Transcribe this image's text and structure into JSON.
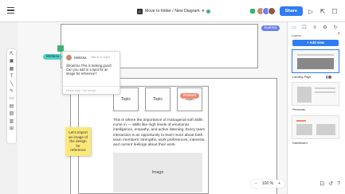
{
  "header": {
    "breadcrumb": "Move to folder / New Diagram",
    "logo_letter": "C",
    "share_label": "Share"
  },
  "canvas": {
    "topics": [
      "Topic",
      "Topic",
      "Topic"
    ],
    "body_text": "This is where the importance of managerial soft skills come in — skills like high levels of emotional intelligence, empathy, and active listening. Every team interaction is an opportunity to learn more about both team members' strengths, work preferences, interests, and current feelings about their work.",
    "image_label": "Image",
    "sticky_note": "Let's import an image of the design for reference",
    "cursors": {
      "katrina": "Katrina",
      "melissa": "Melissa",
      "russell": "Russell"
    }
  },
  "comment": {
    "author": "Melissa",
    "time": "Mar 8 11:11pm",
    "text": "@Katrina This is looking good! Can you add in a spot for an image for reference?",
    "reply_placeholder": "Reply (use / for emoji)"
  },
  "right_panel": {
    "title": "Layers",
    "add_view_label": "+ Add view",
    "views": [
      "Landing Page",
      "Personas",
      "Dashboard"
    ]
  },
  "bottom": {
    "zoom": "100 %"
  },
  "colors": {
    "accent": "#2f7cf6",
    "katrina": "#6a7ff5",
    "melissa": "#4fd1c5",
    "russell": "#f08a72",
    "sticky": "#fbe879"
  }
}
